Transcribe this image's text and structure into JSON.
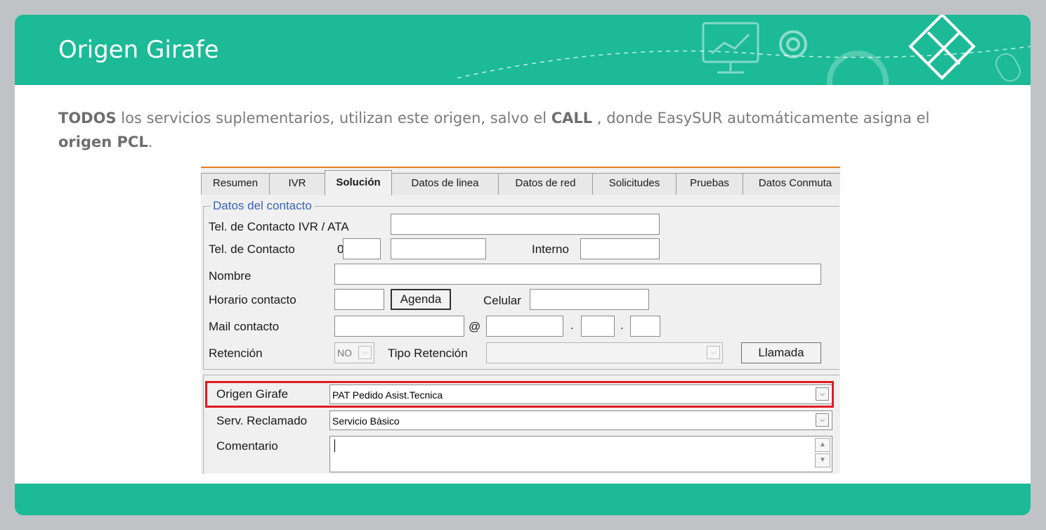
{
  "header": {
    "title": "Origen Girafe"
  },
  "body": {
    "paragraph": [
      {
        "text": "TODOS",
        "bold": true
      },
      {
        "text": " los servicios suplementarios, utilizan este origen, salvo el ",
        "bold": false
      },
      {
        "text": "CALL",
        "bold": true
      },
      {
        "text": " , donde EasySUR automáticamente  asigna el ",
        "bold": false
      },
      {
        "text": "origen PCL",
        "bold": true
      },
      {
        "text": ".",
        "bold": false
      }
    ]
  },
  "form": {
    "tabs": [
      "Resumen",
      "IVR",
      "Solución",
      "Datos de linea",
      "Datos de red",
      "Solicitudes",
      "Pruebas",
      "Datos Conmuta"
    ],
    "active_tab": "Solución",
    "group_title": "Datos del contacto",
    "labels": {
      "tel_ivr": "Tel. de Contacto IVR / ATA",
      "tel": "Tel. de Contacto",
      "tel_prefix": "0",
      "interno": "Interno",
      "nombre": "Nombre",
      "horario": "Horario contacto",
      "celular": "Celular",
      "mail": "Mail contacto",
      "at": "@",
      "dot1": ".",
      "dot2": ".",
      "retencion": "Retención",
      "tipo_retencion": "Tipo Retención",
      "origen": "Origen Girafe",
      "serv": "Serv. Reclamado",
      "comentario": "Comentario"
    },
    "buttons": {
      "agenda": "Agenda",
      "llamada": "Llamada"
    },
    "values": {
      "retencion": "NO",
      "origen": "PAT Pedido Asist.Tecnica",
      "serv": "Servicio Básico"
    }
  },
  "colors": {
    "header": "#1cba97",
    "highlight": "#e11b22",
    "group_title": "#3a63b8",
    "accent_line": "#e87e1f"
  }
}
